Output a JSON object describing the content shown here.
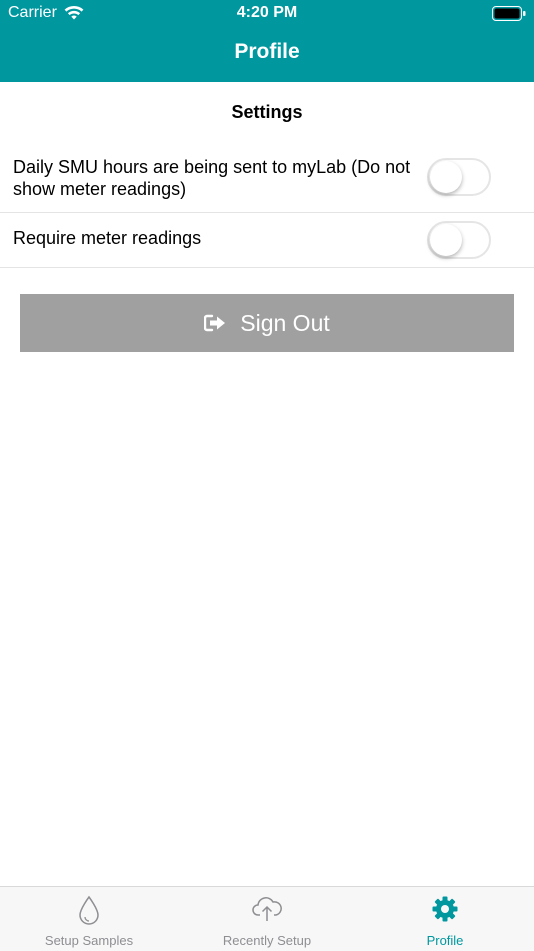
{
  "status_bar": {
    "carrier": "Carrier",
    "time": "4:20 PM"
  },
  "nav": {
    "title": "Profile"
  },
  "settings": {
    "section_title": "Settings",
    "items": [
      {
        "label": "Daily SMU hours are being sent to myLab (Do not show meter readings)",
        "enabled": false
      },
      {
        "label": "Require meter readings",
        "enabled": false
      }
    ]
  },
  "sign_out": {
    "label": "Sign Out",
    "icon": "sign-out-icon"
  },
  "tab_bar": {
    "tabs": [
      {
        "label": "Setup Samples",
        "icon": "droplet-icon",
        "active": false
      },
      {
        "label": "Recently Setup",
        "icon": "cloud-upload-icon",
        "active": false
      },
      {
        "label": "Profile",
        "icon": "gear-icon",
        "active": true
      }
    ]
  },
  "colors": {
    "brand": "#00979f",
    "button_gray": "#a0a0a0",
    "inactive_tab": "#8e8e93"
  }
}
